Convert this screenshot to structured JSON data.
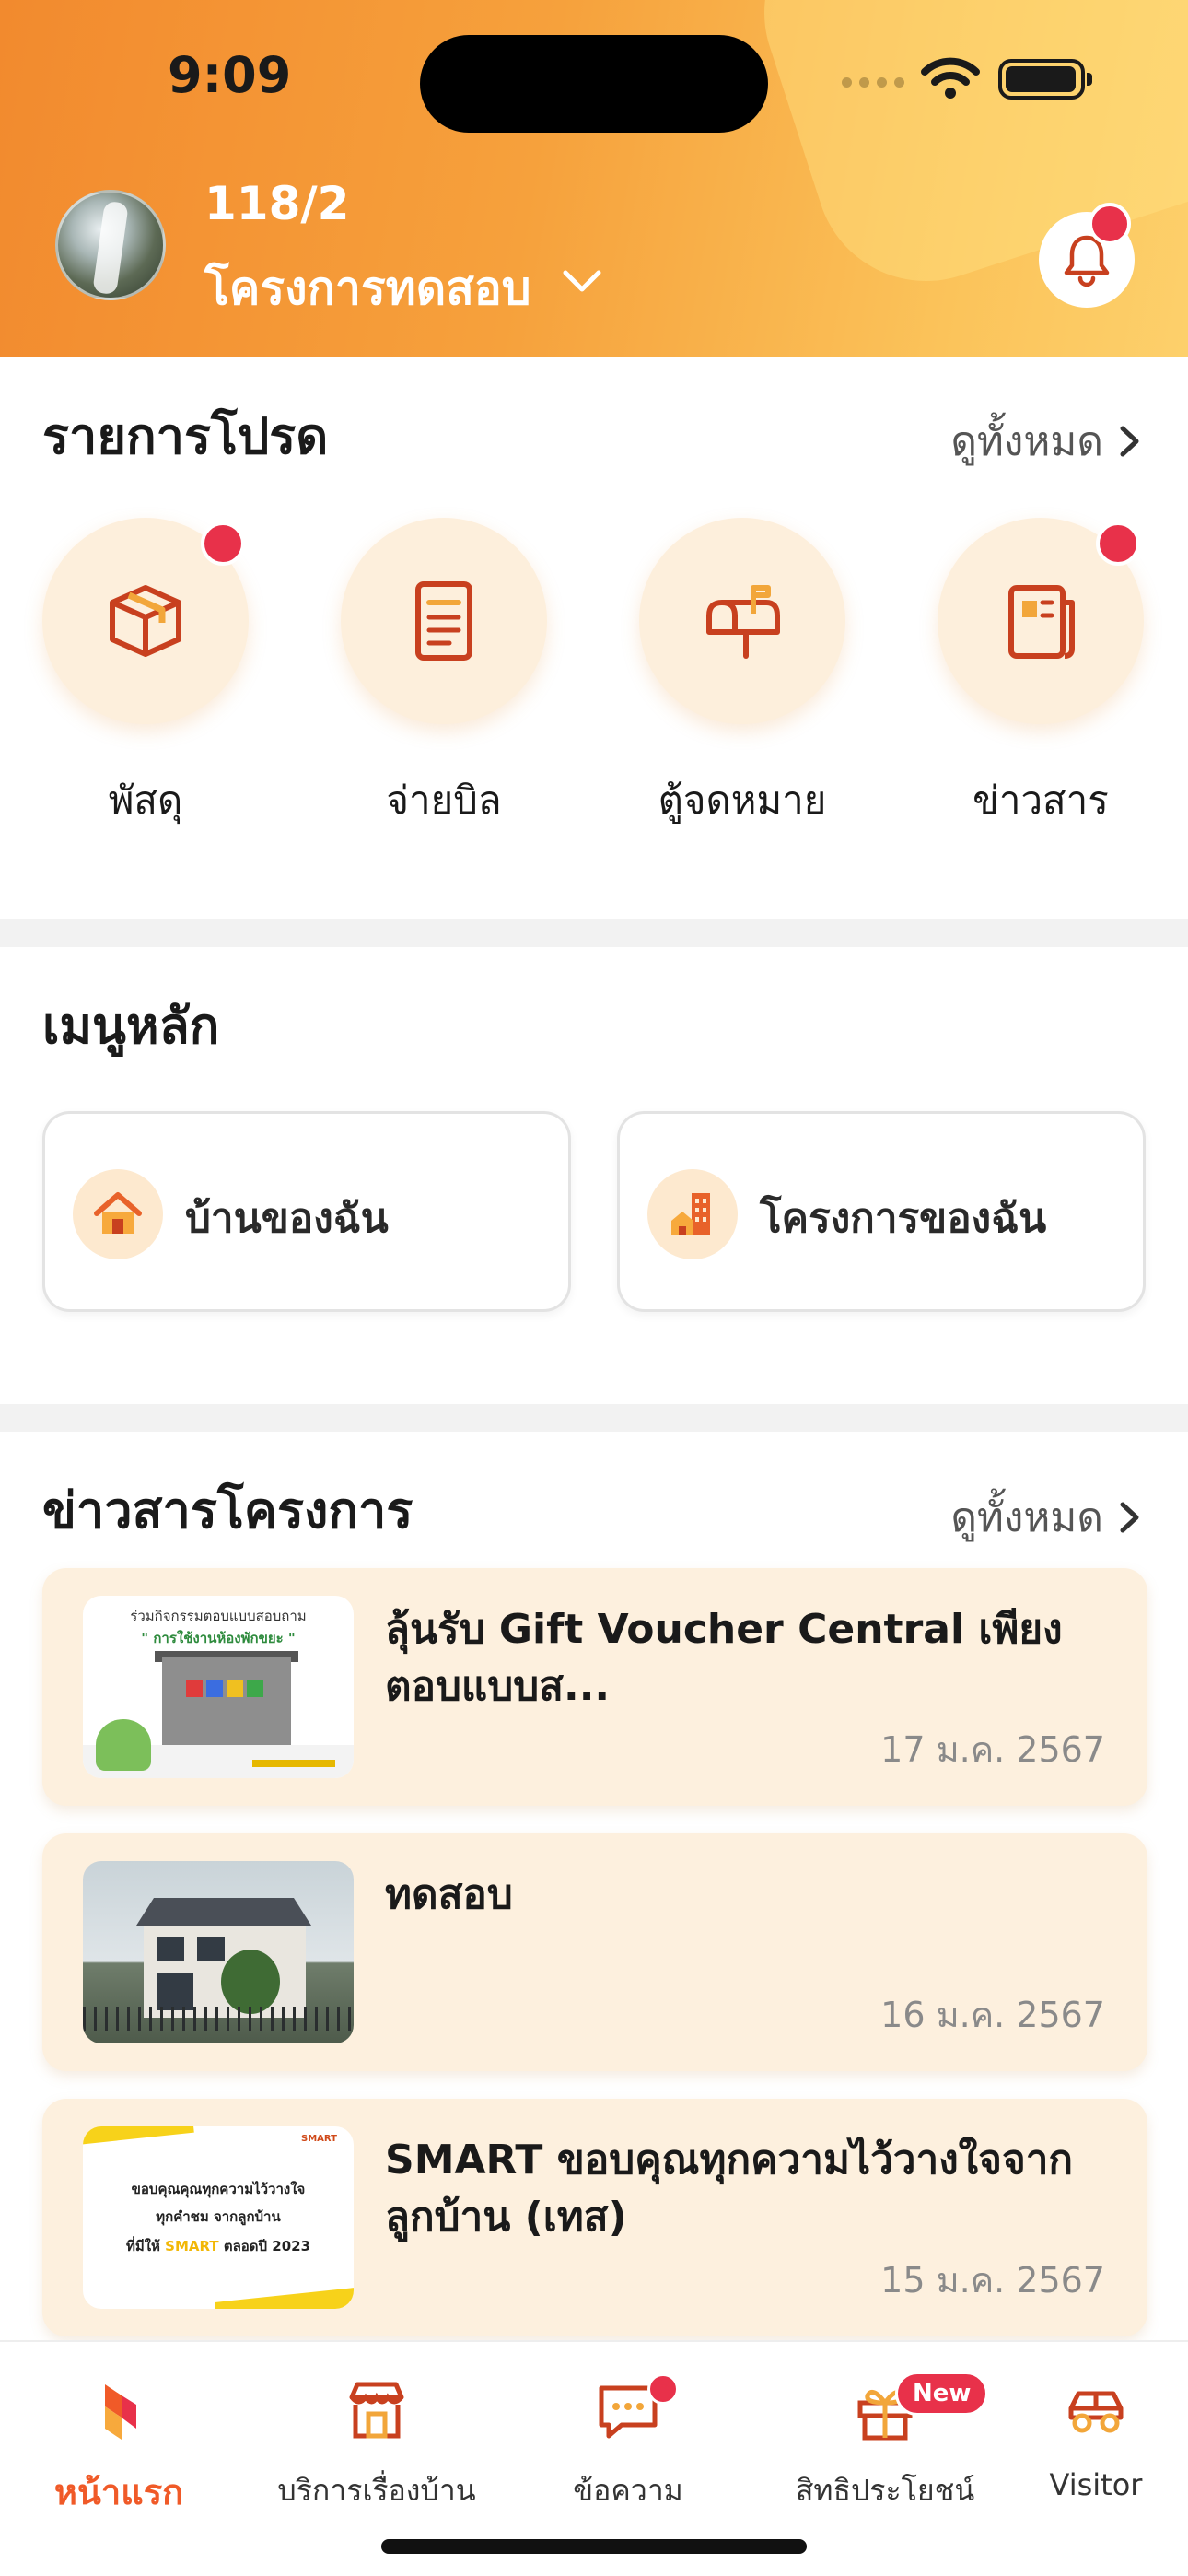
{
  "status_bar": {
    "time": "9:09"
  },
  "header": {
    "unit_no": "118/2",
    "project_name": "โครงการทดสอบ",
    "notification_dot": true
  },
  "favorites": {
    "title": "รายการโปรด",
    "see_all": "ดูทั้งหมด",
    "items": [
      {
        "label": "พัสดุ",
        "icon": "package-icon",
        "has_dot": true
      },
      {
        "label": "จ่ายบิล",
        "icon": "bill-icon",
        "has_dot": false
      },
      {
        "label": "ตู้จดหมาย",
        "icon": "mailbox-icon",
        "has_dot": false
      },
      {
        "label": "ข่าวสาร",
        "icon": "newspaper-icon",
        "has_dot": true
      }
    ]
  },
  "main_menu": {
    "title": "เมนูหลัก",
    "items": [
      {
        "label": "บ้านของฉัน",
        "icon": "house-icon"
      },
      {
        "label": "โครงการของฉัน",
        "icon": "building-icon"
      }
    ]
  },
  "news": {
    "title": "ข่าวสารโครงการ",
    "see_all": "ดูทั้งหมด",
    "items": [
      {
        "title": "ลุ้นรับ Gift Voucher Central เพียงตอบแบบส...",
        "date": "17 ม.ค. 2567",
        "thumb_text_1": "ร่วมกิจกรรมตอบแบบสอบถาม",
        "thumb_text_2": "\" การใช้งานห้องพักขยะ \""
      },
      {
        "title": "ทดสอบ",
        "date": "16 ม.ค. 2567"
      },
      {
        "title": "SMART ขอบคุณทุกความไว้วางใจจากลูกบ้าน (เทส)",
        "date": "15 ม.ค. 2567",
        "thumb_logo": "SMART",
        "thumb_line_1": "ขอบคุณคุณทุกความไว้วางใจ",
        "thumb_line_2": "ทุกคำชม จากลูกบ้าน",
        "thumb_line_3a": "ที่มีให้ ",
        "thumb_line_3b": "SMART",
        "thumb_line_3c": " ตลอดปี 2023"
      }
    ]
  },
  "tabbar": {
    "items": [
      {
        "label": "หน้าแรก",
        "active": true,
        "icon": "home-logo-icon"
      },
      {
        "label": "บริการเรื่องบ้าน",
        "active": false,
        "icon": "store-icon"
      },
      {
        "label": "ข้อความ",
        "active": false,
        "icon": "chat-icon",
        "has_dot": true
      },
      {
        "label": "สิทธิประโยชน์",
        "active": false,
        "icon": "gift-icon",
        "badge": "New"
      },
      {
        "label": "Visitor",
        "active": false,
        "icon": "car-icon"
      }
    ]
  },
  "colors": {
    "accent": "#f05a28",
    "icon_stroke": "#c8401f",
    "notification_red": "#e8314a",
    "card_bg": "#fdf0de"
  }
}
